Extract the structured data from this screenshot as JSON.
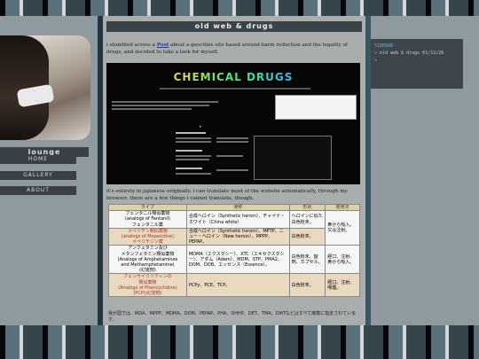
{
  "page": {
    "title": "old web & drugs"
  },
  "left_sidebar": {
    "title": "lounge",
    "nav": [
      "HOME",
      "GALLERY",
      "ABOUT"
    ]
  },
  "right_sidebar": {
    "header": "SIDEBAR",
    "entry": "— old web & drugs 01/12/26",
    "extra": "—"
  },
  "intro": {
    "before_link": "i stumbled across a ",
    "link": "Post",
    "after_link": " about a geocities site based around harm reduction and the legality of drugs, and decided to take a look for myself."
  },
  "embedded_site": {
    "heading": "CHEMICAL DRUGS"
  },
  "mid_text": "it's entirely in japanese originally. i can translate most of the website automatically, through my browser. there are a few things i cannot translate, though.",
  "table": {
    "headers": [
      "タイプ",
      "通称",
      "形状",
      "使用法"
    ],
    "rows": [
      {
        "style": "white",
        "names": [
          "フェンタニル類似薬物",
          "(analogs of Fantanil)",
          "フェンタニル薬"
        ],
        "nickname": "合成ヘロイン（Synthetic heroin）、チャイナ・ホワイト（China white）",
        "form": "ヘロインに似た白色粉末。",
        "usage": "鼻から吸入。"
      },
      {
        "style": "tan",
        "names": [
          "メペリチン類似薬物",
          "(analogs of Meperidine)",
          "メペリチジン薬"
        ],
        "nickname": "合成ヘロイン（Synthetic heroin）、MPTP、ニュー・ヘロイン（New heroin）、MPPP、PEPAP。",
        "form": "白色粉末。",
        "usage": "又は注射。"
      },
      {
        "style": "white",
        "names": [
          "アンフェタミン及び",
          "メタンフェタミン類似薬物",
          "(Analogs of Amphetamines",
          "and Methamphetamine)",
          "(幻覚剤)"
        ],
        "nickname": "MDMA（エクスタシー）、XTC（エキセクスタシー）、アダム（Adam）、MDM、STP、PMA2、DOM、DOB、エッセンス（Essence）。",
        "form": "白色粉末、錠剤、カプセル。",
        "usage": "経口、注射、鼻から吸入。"
      },
      {
        "style": "tan",
        "names": [
          "フェンサイクリディンの",
          "類似薬物",
          "(Analogs of Phencyclidine)",
          "(PCP)(幻覚剤)"
        ],
        "nickname": "PCPy、PCE、TCP。",
        "form": "白色粉末。",
        "usage": "経口、注射、喫煙。"
      }
    ]
  },
  "footer_text": "我が国では、MDA、MPPP、MDMA、DOM、PEPAP、PHA、DHHP、DET、TMA、DMTなどはすべて麻薬に指定されています。"
}
